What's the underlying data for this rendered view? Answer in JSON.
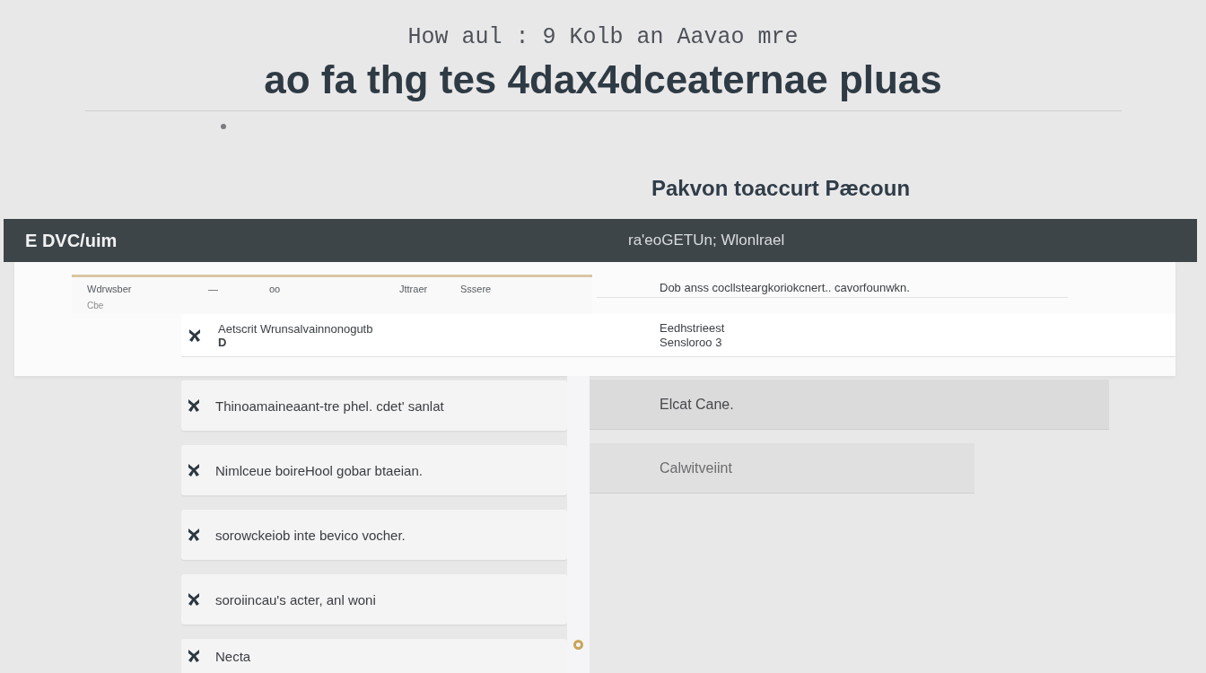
{
  "header": {
    "subtitle": "How aul : 9 Kolb an Aavao mre",
    "title": "ao fa thg tes 4dax4dceaternae pluas"
  },
  "section_heading": "Pakvon toaccurt Pæcoun",
  "bar": {
    "label": "E DVC/uim",
    "caption": "ra'eoGETUn; Wlonlrael"
  },
  "table": {
    "columns": [
      {
        "label": "Wdrwsber",
        "sublabel": "Cbe"
      },
      {
        "label": "—"
      },
      {
        "label": "oo"
      },
      {
        "label": "Jttraer"
      },
      {
        "label": "Sssere"
      }
    ],
    "note": "Dob anss cocllsteargkoriokcnert.. cavorfounwkn."
  },
  "featured_row": {
    "text": "Aetscrit Wrunsalvainnonogutb",
    "subtext": "D",
    "details": [
      "Eedhstrieest",
      "Sensloroo 3"
    ]
  },
  "items": [
    {
      "text": "Thinoamaineaant-tre phel. cdet' sanlat"
    },
    {
      "text": "Nimlceue boireHool gobar btaeian."
    },
    {
      "text": "sorowckeiob inte bevico vocher."
    },
    {
      "text": "soroiincau's acter, anl woni"
    },
    {
      "text": "Necta"
    }
  ],
  "side_cells": [
    {
      "text": "Elcat Cane."
    },
    {
      "text": "Calwitveiint"
    }
  ]
}
